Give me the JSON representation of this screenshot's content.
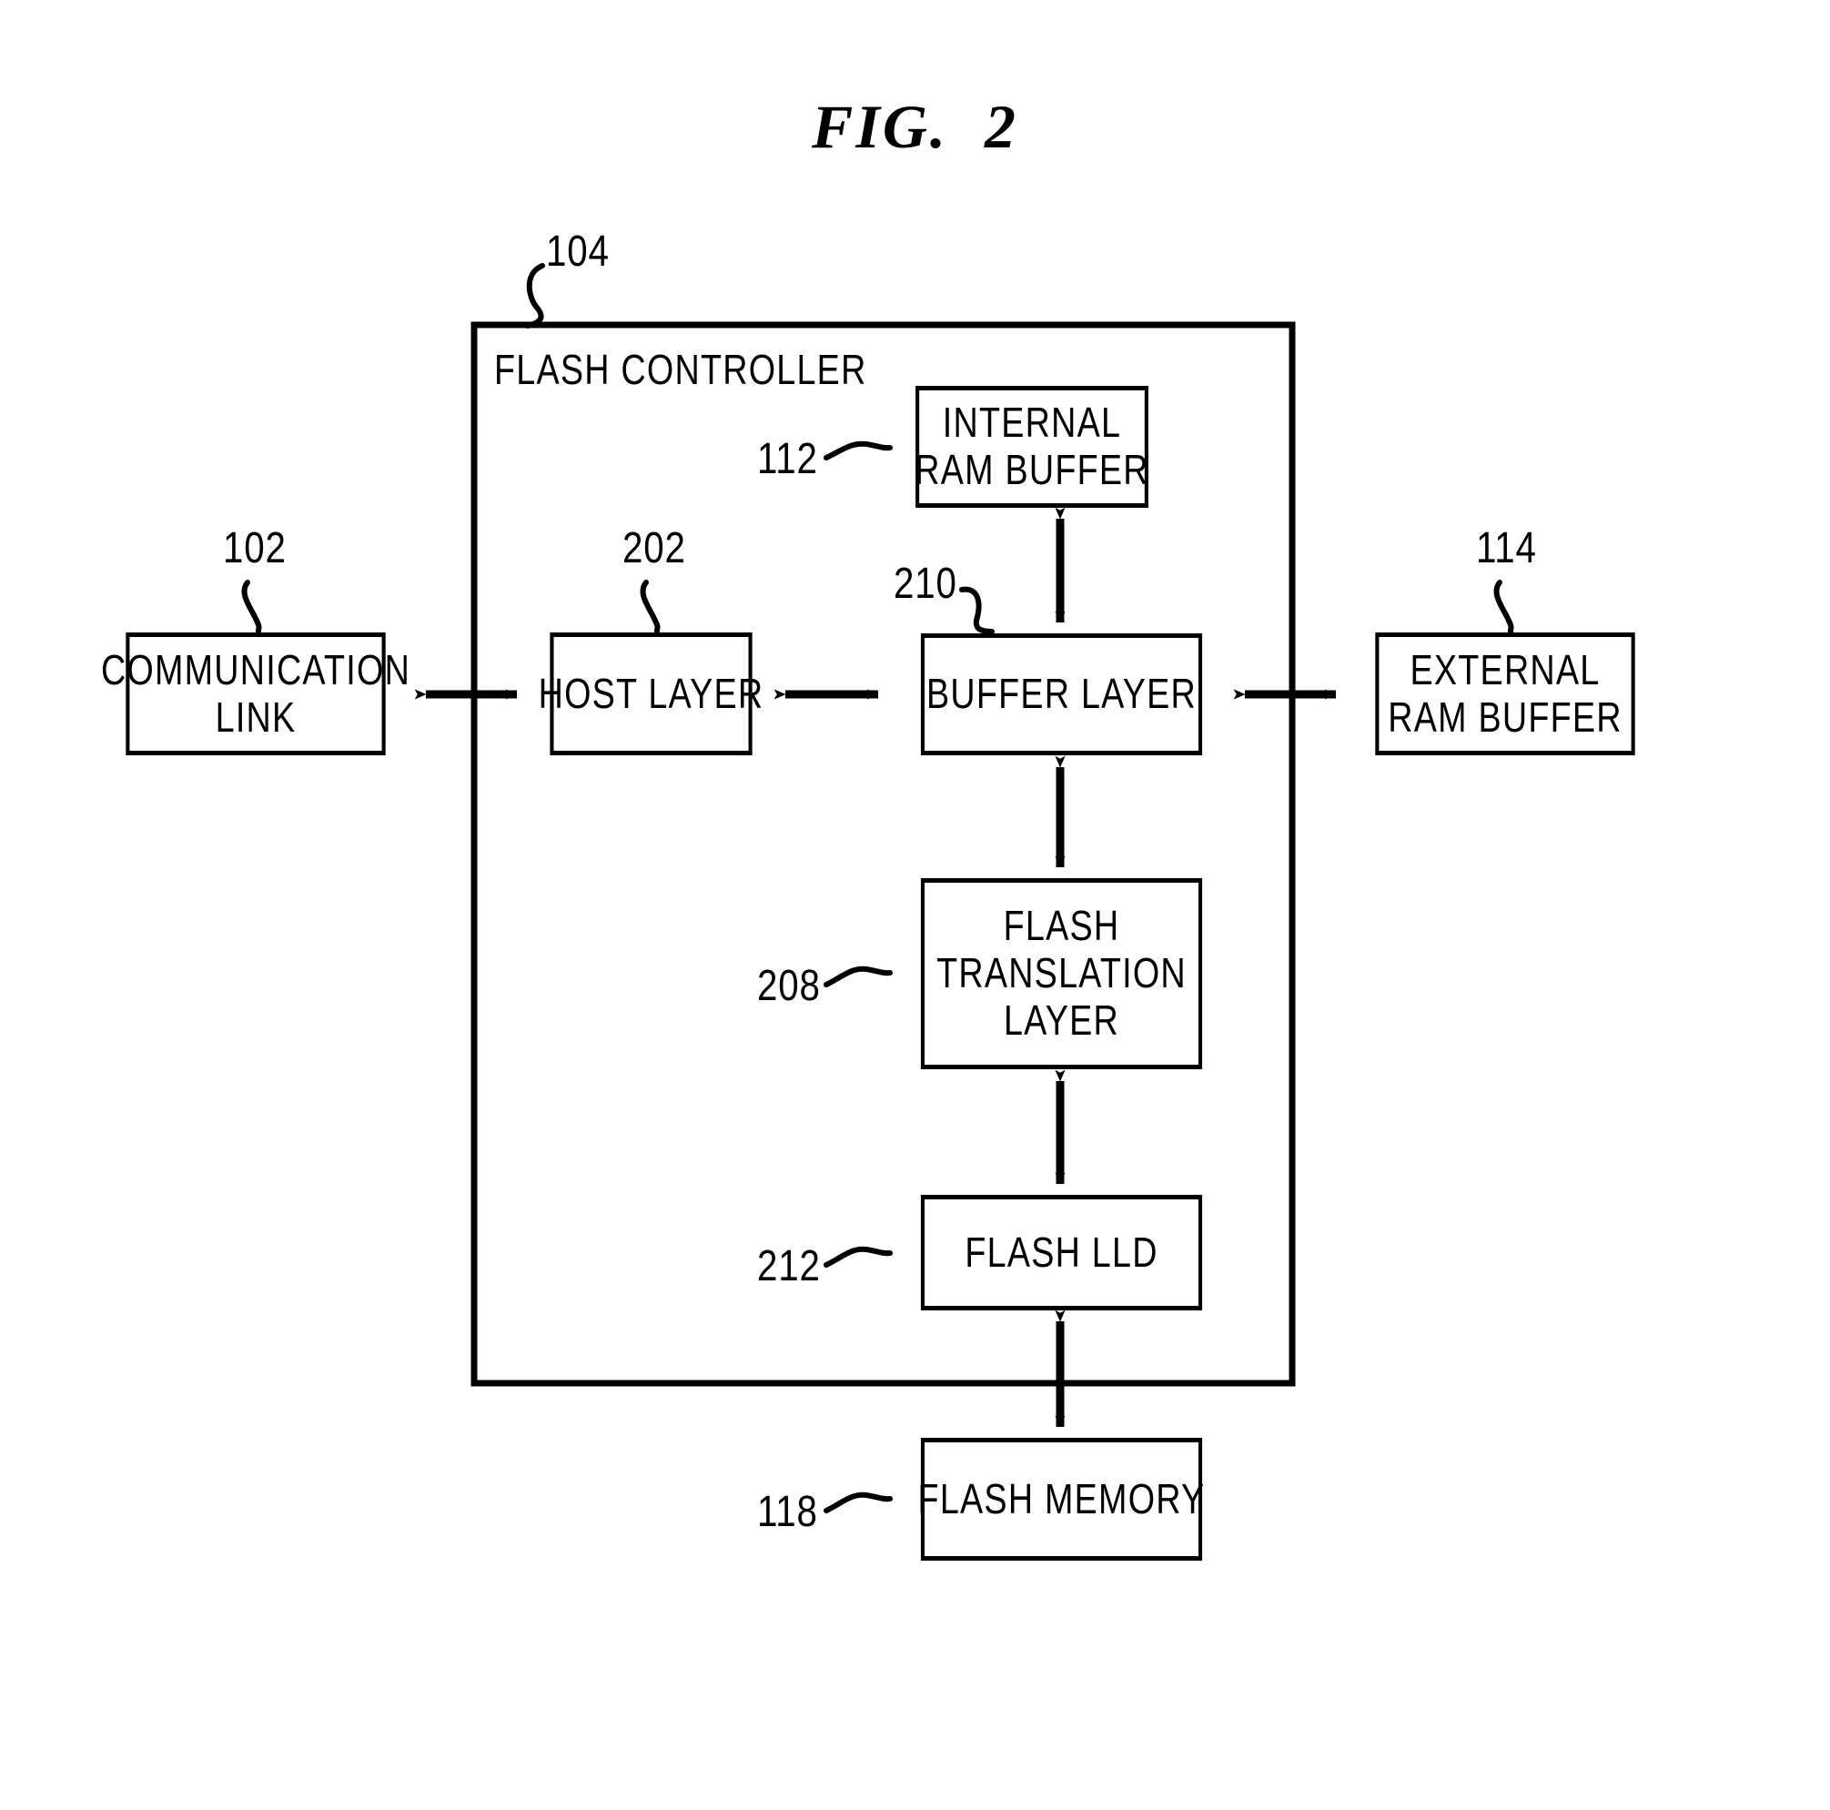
{
  "figure": {
    "title": "FIG.  2",
    "type": "patent-block-diagram"
  },
  "outer_container": {
    "ref": "104",
    "label": "FLASH CONTROLLER"
  },
  "blocks": [
    {
      "id": "communication-link",
      "ref": "102",
      "lines": [
        "COMMUNICATION",
        "LINK"
      ]
    },
    {
      "id": "host-layer",
      "ref": "202",
      "lines": [
        "HOST LAYER"
      ]
    },
    {
      "id": "buffer-layer",
      "ref": "210",
      "lines": [
        "BUFFER LAYER"
      ]
    },
    {
      "id": "external-ram-buffer",
      "ref": "114",
      "lines": [
        "EXTERNAL",
        "RAM BUFFER"
      ]
    },
    {
      "id": "internal-ram-buffer",
      "ref": "112",
      "lines": [
        "INTERNAL",
        "RAM BUFFER"
      ]
    },
    {
      "id": "flash-translation-layer",
      "ref": "208",
      "lines": [
        "FLASH",
        "TRANSLATION",
        "LAYER"
      ]
    },
    {
      "id": "flash-lld",
      "ref": "212",
      "lines": [
        "FLASH LLD"
      ]
    },
    {
      "id": "flash-memory",
      "ref": "118",
      "lines": [
        "FLASH MEMORY"
      ]
    }
  ],
  "connections": [
    {
      "from": "communication-link",
      "to": "host-layer",
      "style": "double-arrow-horizontal"
    },
    {
      "from": "host-layer",
      "to": "buffer-layer",
      "style": "double-arrow-horizontal"
    },
    {
      "from": "buffer-layer",
      "to": "external-ram-buffer",
      "style": "double-arrow-horizontal"
    },
    {
      "from": "internal-ram-buffer",
      "to": "buffer-layer",
      "style": "double-arrow-vertical"
    },
    {
      "from": "buffer-layer",
      "to": "flash-translation-layer",
      "style": "double-arrow-vertical"
    },
    {
      "from": "flash-translation-layer",
      "to": "flash-lld",
      "style": "double-arrow-vertical"
    },
    {
      "from": "flash-lld",
      "to": "flash-memory",
      "style": "double-arrow-vertical"
    }
  ],
  "colors": {
    "stroke": "#000000",
    "background": "#ffffff"
  }
}
